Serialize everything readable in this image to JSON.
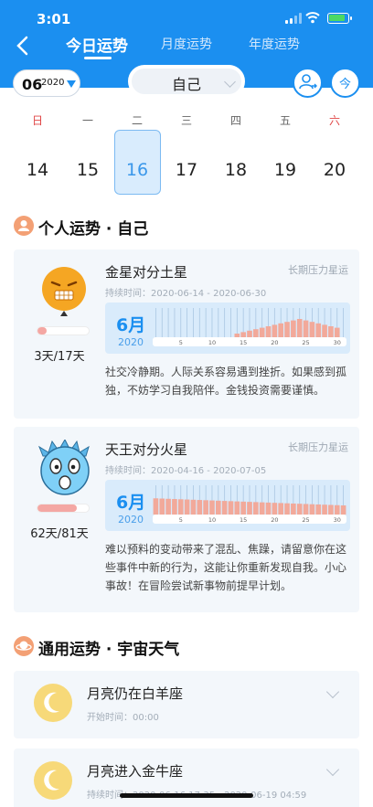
{
  "status_bar": {
    "time": "3:01"
  },
  "tabs": [
    {
      "label": "今日运势",
      "active": true
    },
    {
      "label": "月度运势",
      "active": false
    },
    {
      "label": "年度运势",
      "active": false
    }
  ],
  "date_picker": {
    "month": "06",
    "year": "2020"
  },
  "person_selector": {
    "value": "自己"
  },
  "today_button": {
    "label": "今"
  },
  "weekdays": [
    "日",
    "一",
    "二",
    "三",
    "四",
    "五",
    "六"
  ],
  "days": [
    "14",
    "15",
    "16",
    "17",
    "18",
    "19",
    "20"
  ],
  "selected_day": "16",
  "personal_section": {
    "title": "个人运势 · 自己"
  },
  "transits": [
    {
      "title": "金星对分土星",
      "tag": "长期压力星运",
      "duration": "持续时间：2020-06-14 - 2020-06-30",
      "month_label": "6月",
      "year_label": "2020",
      "ticks": [
        "5",
        "10",
        "15",
        "20",
        "25",
        "30"
      ],
      "description": "社交冷静期。人际关系容易遇到挫折。如果感到孤独，不妨学习自我陪伴。金钱投资需要谨慎。",
      "count": "3天/17天",
      "progress": 0.18
    },
    {
      "title": "天王对分火星",
      "tag": "长期压力星运",
      "duration": "持续时间：2020-04-16 - 2020-07-05",
      "month_label": "6月",
      "year_label": "2020",
      "ticks": [
        "5",
        "10",
        "15",
        "20",
        "25",
        "30"
      ],
      "description": "难以预料的变动带来了混乱、焦躁，请留意你在这些事件中新的行为，这能让你重新发现自我。小心事故！在冒险尝试新事物前提早计划。",
      "count": "62天/81天",
      "progress": 0.77
    }
  ],
  "general_section": {
    "title": "通用运势 · 宇宙天气"
  },
  "weather": [
    {
      "title": "月亮仍在白羊座",
      "sub": "开始时间：00:00"
    },
    {
      "title": "月亮进入金牛座",
      "sub": "持续时间：2020-06-16 17:35 - 2020-06-19 04:59"
    }
  ],
  "colors": {
    "brand": "#1b8ff0",
    "accent": "#f3a075",
    "bar": "#f4a7a3"
  }
}
